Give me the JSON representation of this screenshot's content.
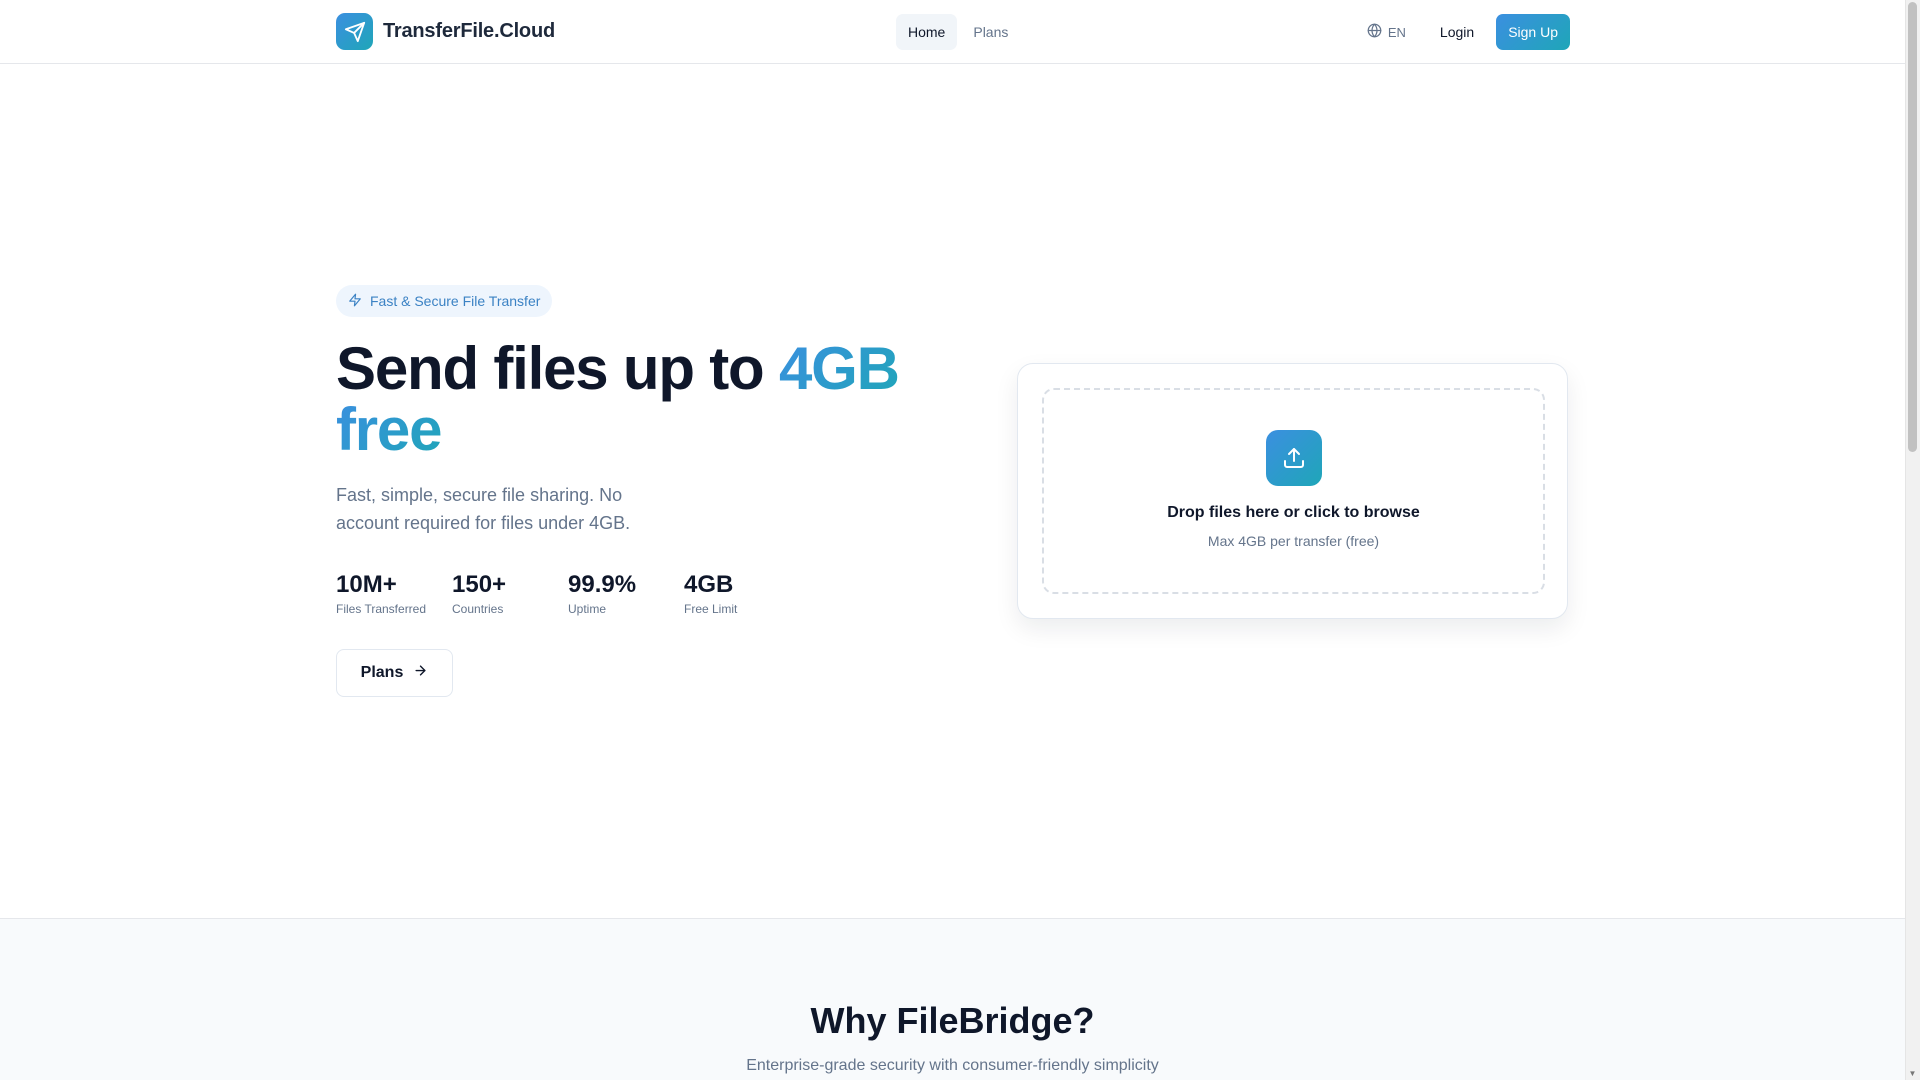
{
  "header": {
    "brand": "TransferFile.Cloud",
    "nav": [
      {
        "label": "Home",
        "active": true
      },
      {
        "label": "Plans",
        "active": false
      }
    ],
    "language": "EN",
    "login_label": "Login",
    "signup_label": "Sign Up"
  },
  "hero": {
    "badge": "Fast & Secure File Transfer",
    "title_part1": "Send files up to ",
    "title_highlight1": "4GB",
    "title_highlight2": "free",
    "subtitle": "Fast, simple, secure file sharing. No account required for files under 4GB.",
    "stats": [
      {
        "value": "10M+",
        "label": "Files Transferred"
      },
      {
        "value": "150+",
        "label": "Countries"
      },
      {
        "value": "99.9%",
        "label": "Uptime"
      },
      {
        "value": "4GB",
        "label": "Free Limit"
      }
    ],
    "plans_button": "Plans"
  },
  "upload": {
    "title": "Drop files here or click to browse",
    "subtitle": "Max 4GB per transfer (free)"
  },
  "why": {
    "title": "Why FileBridge?",
    "subtitle": "Enterprise-grade security with consumer-friendly simplicity"
  },
  "colors": {
    "accent_start": "#3b8fe0",
    "accent_end": "#1fa6b8",
    "text_primary": "#0f172a",
    "text_muted": "#64748b"
  }
}
